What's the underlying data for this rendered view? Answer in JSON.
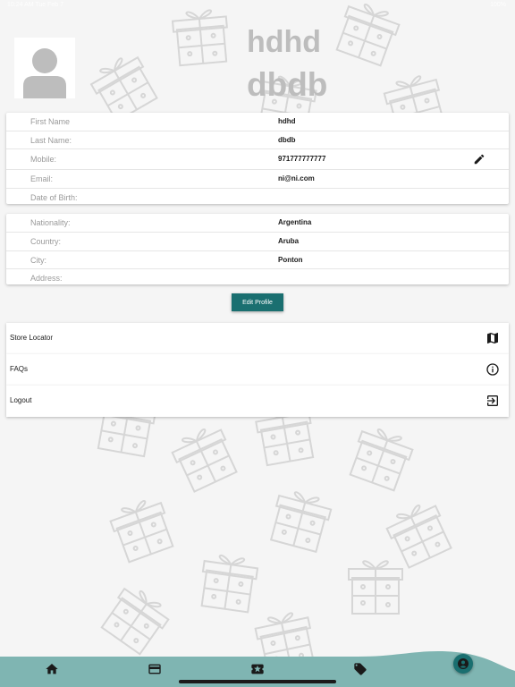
{
  "status_bar": {
    "left": "10:24 AM Tue Feb 7",
    "right": "100%"
  },
  "profile": {
    "first_name": "hdhd",
    "last_name": "dbdb"
  },
  "personal_info": [
    {
      "label": "First Name",
      "value": "hdhd",
      "editable": false
    },
    {
      "label": "Last Name:",
      "value": "dbdb",
      "editable": false
    },
    {
      "label": "Mobile:",
      "value": "971777777777",
      "editable": true
    },
    {
      "label": "Email:",
      "value": "ni@ni.com",
      "editable": false
    },
    {
      "label": "Date of Birth:",
      "value": "",
      "editable": false
    }
  ],
  "location_info": [
    {
      "label": "Nationality:",
      "value": "Argentina"
    },
    {
      "label": "Country:",
      "value": "Aruba"
    },
    {
      "label": "City:",
      "value": "Ponton"
    },
    {
      "label": "Address:",
      "value": ""
    }
  ],
  "edit_profile_label": "Edit Profile",
  "menu": [
    {
      "label": "Store Locator",
      "icon": "map-icon"
    },
    {
      "label": "FAQs",
      "icon": "info-icon"
    },
    {
      "label": "Logout",
      "icon": "logout-icon"
    }
  ],
  "bottom_nav": [
    {
      "icon": "home-icon"
    },
    {
      "icon": "card-icon"
    },
    {
      "icon": "ticket-icon"
    },
    {
      "icon": "tag-icon"
    },
    {
      "icon": "profile-icon",
      "active": true
    }
  ],
  "colors": {
    "accent": "#1a6f70",
    "nav_background": "#7fb5b2",
    "background": "#f5f5f5",
    "name_text": "#bdbdbd"
  }
}
